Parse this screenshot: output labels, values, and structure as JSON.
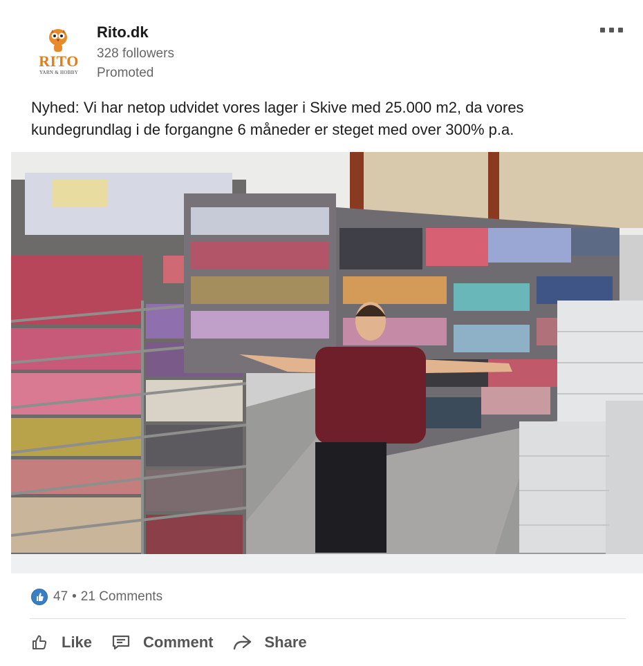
{
  "post": {
    "author": {
      "name": "Rito.dk",
      "followers": "328 followers",
      "status": "Promoted",
      "logo_text": "RITO",
      "logo_subtext": "YARN & HOBBY"
    },
    "text": "Nyhed: Vi har netop udvidet vores lager i Skive med 25.000 m2, da vores kundegrundlag i de forgangne 6 måneder er steget med over 300% p.a.",
    "image_subject": "warehouse with yarn shelves and man with outstretched arms"
  },
  "social": {
    "reaction_count": "47",
    "separator": "•",
    "comments_label": "21 Comments"
  },
  "actions": {
    "like": "Like",
    "comment": "Comment",
    "share": "Share"
  },
  "colors": {
    "brand_orange": "#e07e1a",
    "reaction_blue": "#3a7fc4",
    "muted_text": "#666666"
  },
  "icons": {
    "more": "more-horizontal-icon",
    "like_reaction": "like-reaction-icon",
    "like": "thumbs-up-icon",
    "comment": "comment-icon",
    "share": "share-arrow-icon"
  }
}
